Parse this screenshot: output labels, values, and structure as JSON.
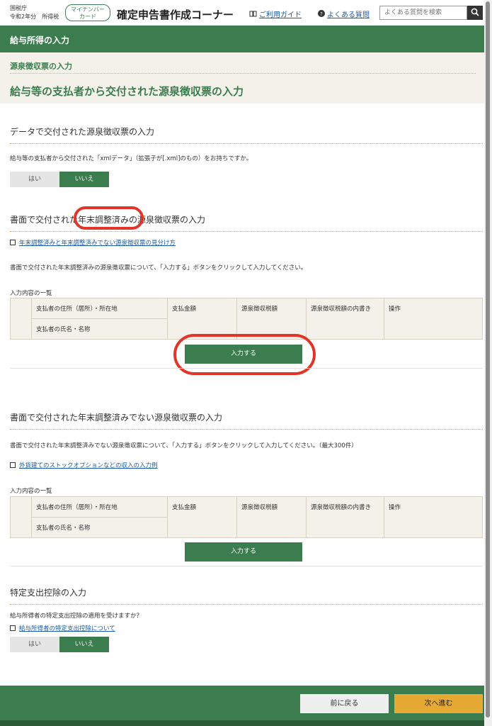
{
  "header": {
    "agency": "国税庁",
    "year": "令和2年分　所得税",
    "mynumber_line1": "マイナンバー",
    "mynumber_line2": "カード",
    "site_title": "確定申告書作成コーナー",
    "guide_icon": "book-icon",
    "guide": "ご利用ガイド",
    "faq_icon": "question-circle-icon",
    "faq": "よくある質問",
    "search_placeholder": "よくある質問を検索",
    "search_icon": "search-icon"
  },
  "section_bar": "給与所得の入力",
  "page_head": {
    "breadcrumb": "源泉徴収票の入力",
    "title": "給与等の支払者から交付された源泉徴収票の入力"
  },
  "data_section": {
    "heading": "データで交付された源泉徴収票の入力",
    "question": "給与等の支払者から交付された「xmlデータ」（拡張子が[.xml]のもの）をお持ちですか。",
    "yes": "はい",
    "no": "いいえ",
    "selected": "いいえ"
  },
  "adjusted_section": {
    "heading": "書面で交付された年末調整済みの源泉徴収票の入力",
    "link": "年末調整済みと年末調整済みでない源泉徴収票の見分け方",
    "instruction": "書面で交付された年末調整済みの源泉徴収票について、「入力する」ボタンをクリックして入力してください。",
    "list_label": "入力内容の一覧",
    "button": "入力する"
  },
  "unadjusted_section": {
    "heading": "書面で交付された年末調整済みでない源泉徴収票の入力",
    "instruction": "書面で交付された年末調整済みでない源泉徴収票について、「入力する」ボタンをクリックして入力してください。（最大300件）",
    "link": "外貨建てのストックオプションなどの収入の入力例",
    "list_label": "入力内容の一覧",
    "button": "入力する"
  },
  "table_headers": {
    "address": "支払者の住所（居所）・所在地",
    "name": "支払者の氏名・名称",
    "amount": "支払金額",
    "tax": "源泉徴収税額",
    "tax_breakdown": "源泉徴収税額の内書き",
    "operation": "操作"
  },
  "deduction_section": {
    "heading": "特定支出控除の入力",
    "question": "給与所得者の特定支出控除の適用を受けますか？",
    "link": "給与所得者の特定支出控除について",
    "yes": "はい",
    "no": "いいえ",
    "selected": "いいえ"
  },
  "footer": {
    "back": "前に戻る",
    "next": "次へ進む"
  },
  "colors": {
    "brand_green": "#3b7d4e",
    "next_orange": "#e6aa34",
    "annotation_red": "#e2352a"
  }
}
